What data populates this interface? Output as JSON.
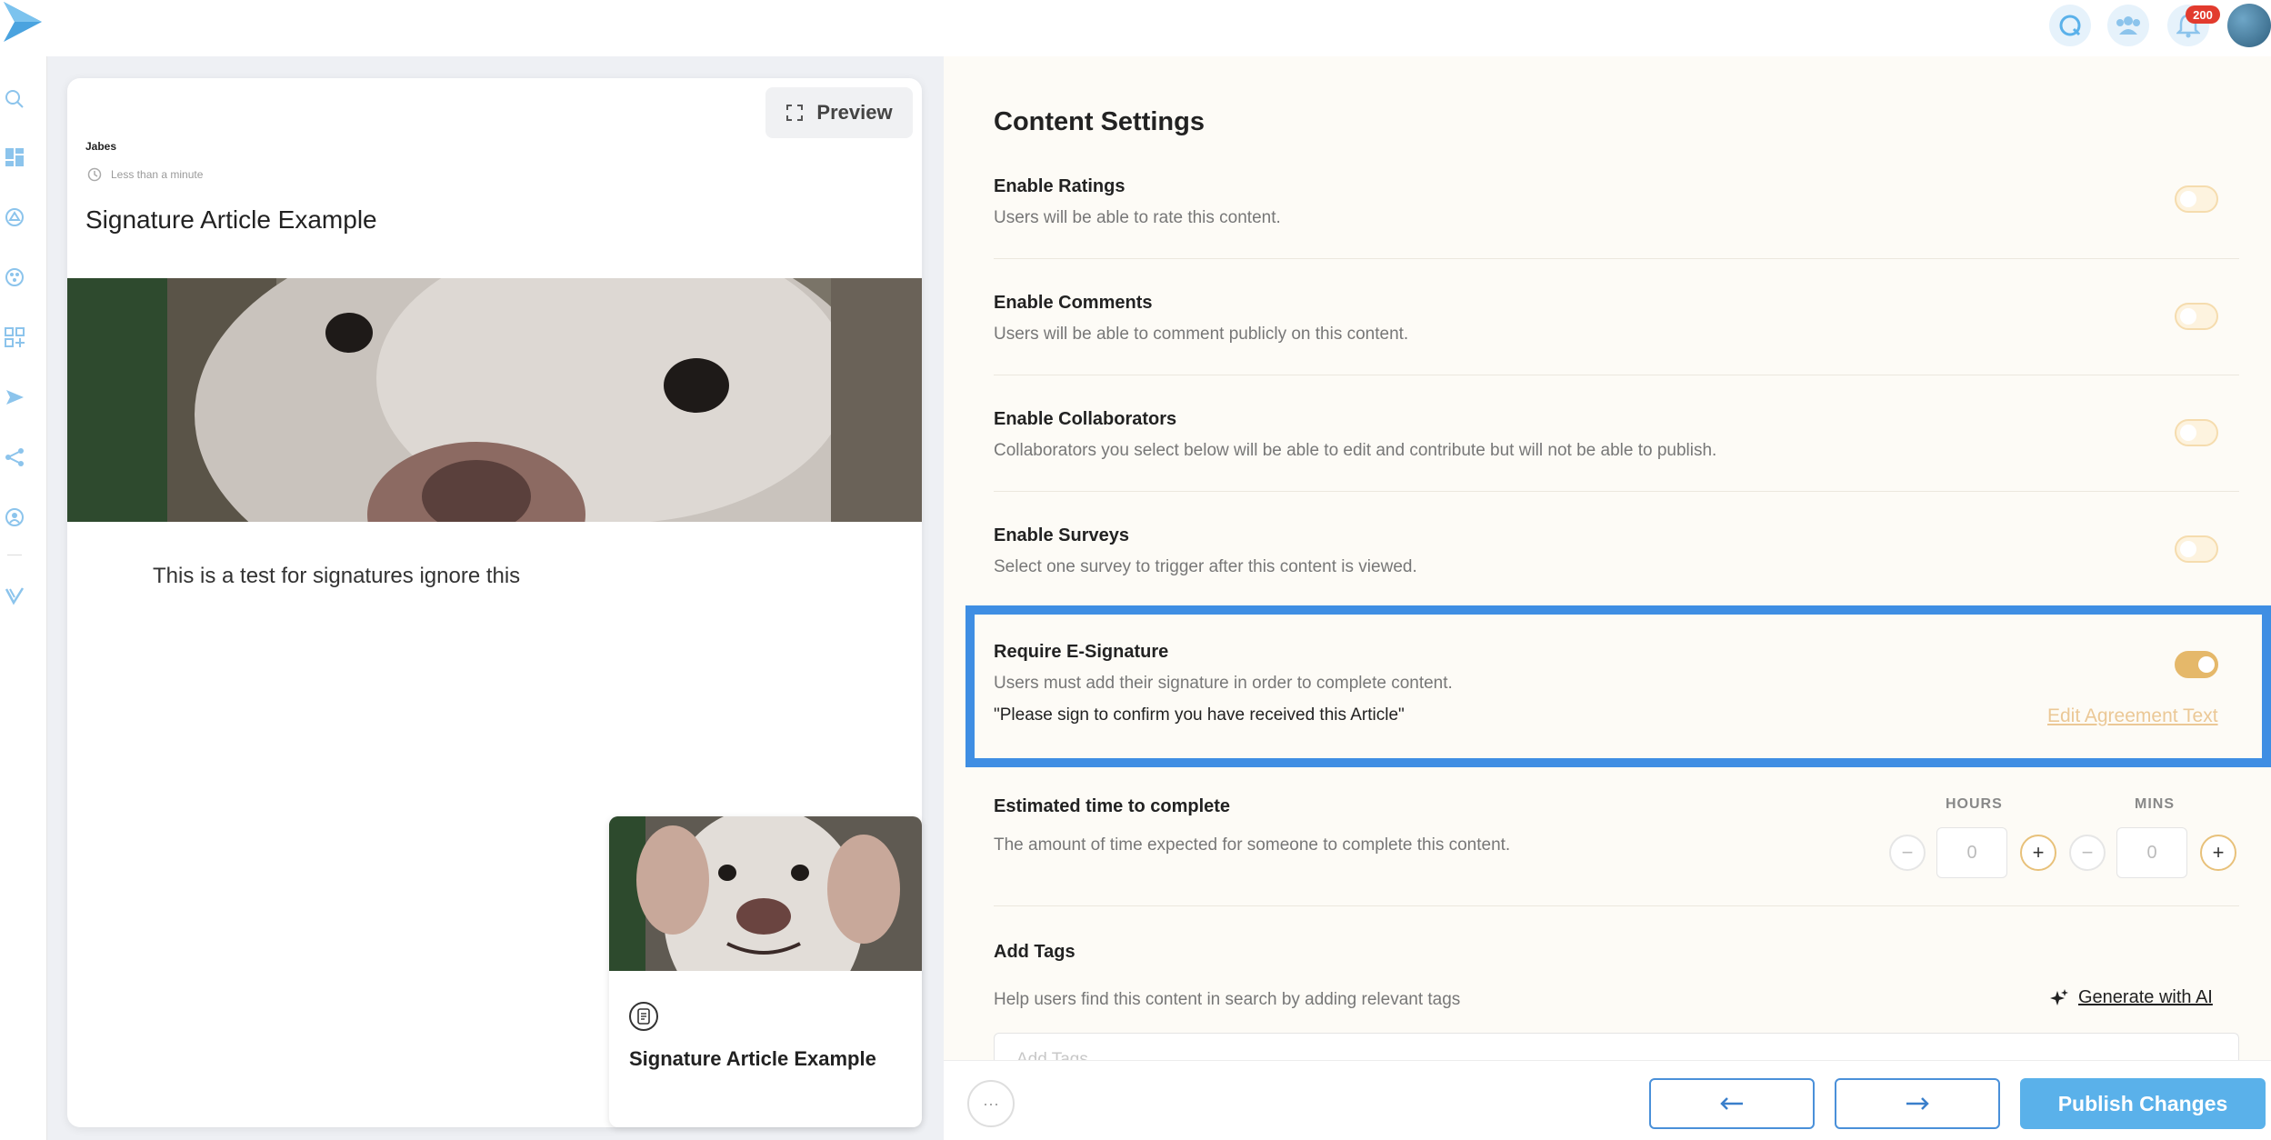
{
  "topbar": {
    "notification_count": "200"
  },
  "preview": {
    "button_label": "Preview",
    "author": "Jabes",
    "read_time": "Less than a minute",
    "title": "Signature Article Example",
    "body": "This is a test for signatures ignore this",
    "card_title": "Signature Article Example"
  },
  "settings": {
    "title": "Content Settings",
    "rows": [
      {
        "title": "Enable Ratings",
        "desc": "Users will be able to rate this content.",
        "enabled": false
      },
      {
        "title": "Enable Comments",
        "desc": "Users will be able to comment publicly on this content.",
        "enabled": false
      },
      {
        "title": "Enable Collaborators",
        "desc": "Collaborators you select below will be able to edit and contribute but will not be able to publish.",
        "enabled": false
      },
      {
        "title": "Enable Surveys",
        "desc": "Select one survey to trigger after this content is viewed.",
        "enabled": false
      },
      {
        "title": "Require E-Signature",
        "desc": "Users must add their signature in order to complete content.",
        "enabled": true
      }
    ],
    "agreement_text": "\"Please sign to confirm you have received this Article\"",
    "edit_agreement_label": "Edit Agreement Text",
    "time": {
      "title": "Estimated time to complete",
      "desc": "The amount of time expected for someone to complete this content.",
      "hours_label": "HOURS",
      "mins_label": "MINS",
      "hours_value": "0",
      "mins_value": "0"
    },
    "tags": {
      "title": "Add Tags",
      "desc": "Help users find this content in search by adding relevant tags",
      "generate_label": "Generate with AI",
      "placeholder": "Add Tags"
    }
  },
  "footer": {
    "more_label": "···",
    "publish_label": "Publish Changes"
  },
  "colors": {
    "accent_blue": "#3f8ee3",
    "publish_blue": "#5ab1ea",
    "toggle_on": "#e5b86a",
    "badge_red": "#e23b2e"
  }
}
